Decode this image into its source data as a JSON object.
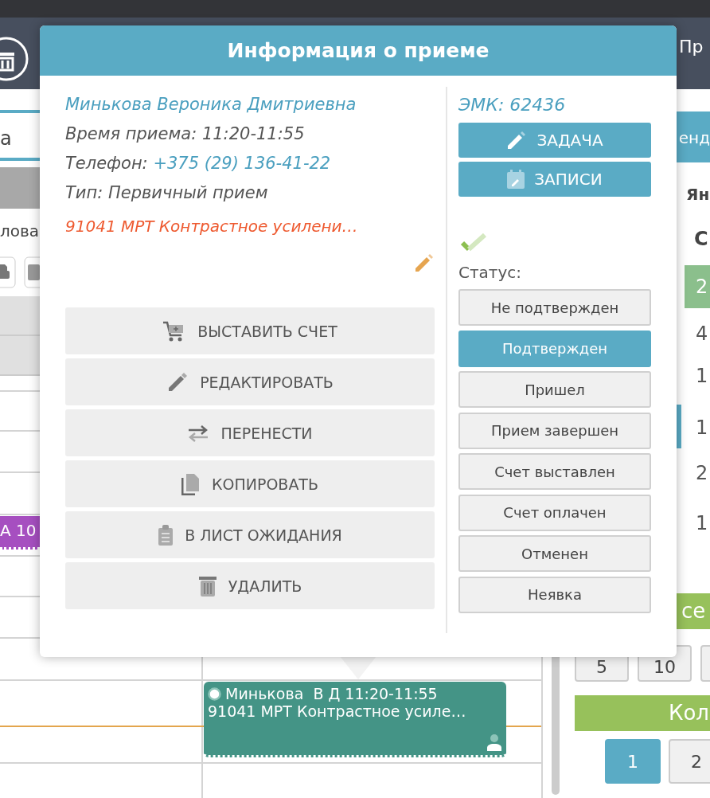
{
  "top_bar": {
    "trailing_text": "Пр"
  },
  "left_panel": {
    "search_value": "а",
    "label_fragment": "лова",
    "event": {
      "text": "А 10",
      "color": "#a64fc0"
    }
  },
  "right_panel": {
    "header": "енд",
    "month": "Ян",
    "weekday": "С",
    "days": [
      {
        "label": "2",
        "selected": true
      },
      {
        "label": "4",
        "selected": false
      },
      {
        "label": "1",
        "selected": false
      },
      {
        "label": "1",
        "selected": false
      },
      {
        "label": "2",
        "selected": false
      },
      {
        "label": "1",
        "selected": false
      }
    ],
    "banner": "се",
    "page_sizes": [
      "5",
      "10"
    ],
    "counter_banner": "Кол",
    "pages": [
      {
        "label": "1",
        "selected": true
      },
      {
        "label": "2",
        "selected": false
      }
    ]
  },
  "calendar_event": {
    "title": "Минькова  В Д 11:20-11:55",
    "detail": "91041 МРТ Контрастное усиле…"
  },
  "dialog": {
    "title": "Информация о приеме",
    "patient_name": "Минькова Вероника Дмитриевна",
    "time_line": "Время приема: 11:20-11:55",
    "phone_label": "Телефон:",
    "phone": "+375 (29) 136-41-22",
    "type_line": "Тип: Первичный прием",
    "service": "91041 МРТ Контрастное усилени…",
    "emk": "ЭМК: 62436",
    "task_button": "ЗАДАЧА",
    "records_button": "ЗАПИСИ",
    "confirmed": true,
    "status_label": "Статус:",
    "statuses": [
      {
        "label": "Не подтвержден",
        "selected": false
      },
      {
        "label": "Подтвержден",
        "selected": true
      },
      {
        "label": "Пришел",
        "selected": false
      },
      {
        "label": "Прием завершен",
        "selected": false
      },
      {
        "label": "Счет выставлен",
        "selected": false
      },
      {
        "label": "Счет оплачен",
        "selected": false
      },
      {
        "label": "Отменен",
        "selected": false
      },
      {
        "label": "Неявка",
        "selected": false
      }
    ],
    "actions": [
      {
        "kind": "invoice",
        "label": "ВЫСТАВИТЬ СЧЕТ"
      },
      {
        "kind": "edit",
        "label": "РЕДАКТИРОВАТЬ"
      },
      {
        "kind": "move",
        "label": "ПЕРЕНЕСТИ"
      },
      {
        "kind": "copy",
        "label": "КОПИРОВАТЬ"
      },
      {
        "kind": "waitlist",
        "label": "В ЛИСТ ОЖИДАНИЯ"
      },
      {
        "kind": "delete",
        "label": "УДАЛИТЬ"
      }
    ]
  }
}
